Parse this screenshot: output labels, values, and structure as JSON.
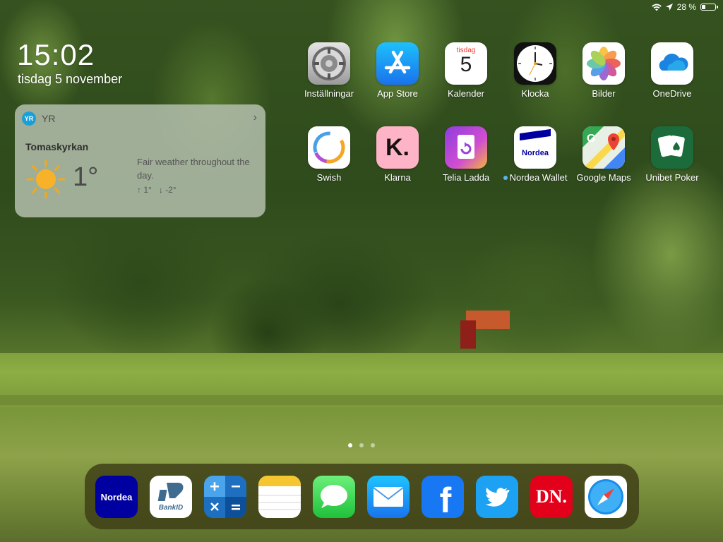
{
  "status": {
    "battery_text": "28 %",
    "battery_level": 0.28
  },
  "lockscreen": {
    "time": "15:02",
    "date": "tisdag 5 november"
  },
  "yr_widget": {
    "app": "YR",
    "logo_text": "YR",
    "location": "Tomaskyrkan",
    "temperature": "1°",
    "description": "Fair weather throughout the day.",
    "max": "1°",
    "min": "-2°"
  },
  "apps_row1": [
    {
      "label": "Inställningar",
      "icon": "settings-icon"
    },
    {
      "label": "App Store",
      "icon": "app-store-icon"
    },
    {
      "label": "Kalender",
      "icon": "calendar-icon",
      "calendar_weekday": "tisdag",
      "calendar_day": "5"
    },
    {
      "label": "Klocka",
      "icon": "clock-icon"
    },
    {
      "label": "Bilder",
      "icon": "photos-icon"
    },
    {
      "label": "OneDrive",
      "icon": "onedrive-icon"
    }
  ],
  "apps_row2": [
    {
      "label": "Swish",
      "icon": "swish-icon"
    },
    {
      "label": "Klarna",
      "icon": "klarna-icon",
      "glyph": "K."
    },
    {
      "label": "Telia Ladda",
      "icon": "telia-ladda-icon"
    },
    {
      "label": "Nordea Wallet",
      "icon": "nordea-wallet-icon",
      "brand": "Nordea"
    },
    {
      "label": "Google Maps",
      "icon": "google-maps-icon"
    },
    {
      "label": "Unibet Poker",
      "icon": "unibet-poker-icon"
    }
  ],
  "dock": [
    {
      "name": "Nordea",
      "icon": "nordea-icon",
      "text": "Nordea"
    },
    {
      "name": "BankID",
      "icon": "bankid-icon",
      "text": "BankID"
    },
    {
      "name": "Kalkylator",
      "icon": "calculator-icon"
    },
    {
      "name": "Anteckningar",
      "icon": "notes-icon"
    },
    {
      "name": "Meddelanden",
      "icon": "messages-icon"
    },
    {
      "name": "Mail",
      "icon": "mail-icon"
    },
    {
      "name": "Facebook",
      "icon": "facebook-icon",
      "text": "f"
    },
    {
      "name": "Twitter",
      "icon": "twitter-icon"
    },
    {
      "name": "DN",
      "icon": "dn-icon",
      "text": "DN."
    },
    {
      "name": "Safari",
      "icon": "safari-icon"
    }
  ],
  "page_dots": {
    "count": 3,
    "active": 1
  }
}
